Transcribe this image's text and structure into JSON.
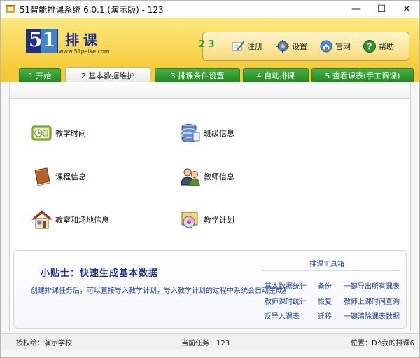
{
  "window": {
    "title": "51智能排课系统 6.0.1 (演示版) - 123",
    "controls": {
      "minimize": "—",
      "maximize": "☐",
      "close": "✕"
    }
  },
  "logo": {
    "digit_5": "5",
    "digit_1": "1",
    "name": "排课",
    "url": "www.51paike.com"
  },
  "toolbar": {
    "number": "2 3",
    "items": [
      {
        "label": "注册",
        "icon": "register-icon"
      },
      {
        "label": "设置",
        "icon": "gear-icon"
      },
      {
        "label": "官网",
        "icon": "website-icon"
      },
      {
        "label": "帮助",
        "icon": "help-icon"
      }
    ]
  },
  "tabs": [
    {
      "label": "1 开始",
      "active": false
    },
    {
      "label": "2 基本数据维护",
      "active": true
    },
    {
      "label": "3 排课条件设置",
      "active": false
    },
    {
      "label": "4 自动排课",
      "active": false
    },
    {
      "label": "5 查看课表(手工调课)",
      "active": false
    }
  ],
  "functions": [
    {
      "label": "教学时间",
      "icon": "teaching-time-icon"
    },
    {
      "label": "班级信息",
      "icon": "class-info-icon"
    },
    {
      "label": "课程信息",
      "icon": "course-book-icon"
    },
    {
      "label": "教师信息",
      "icon": "teachers-icon"
    },
    {
      "label": "教室和场地信息",
      "icon": "classroom-house-icon"
    },
    {
      "label": "教学计划",
      "icon": "teaching-plan-icon"
    }
  ],
  "tips": {
    "title": "小贴士：快速生成基本数据",
    "text": "创建排课任务后，可以直接导入教学计划，导入教学计划的过程中系统会自动生成基本数据"
  },
  "tools": {
    "title": "排课工具箱",
    "links": [
      "基本数据统计",
      "备份",
      "一键导出所有课表",
      "教师课时统计",
      "恢复",
      "教师上课时间查询",
      "反导入课表",
      "迁移",
      "一键清除课表数据"
    ]
  },
  "status": {
    "license": "授权给：演示学校",
    "task": "当前任务：123",
    "location": "位置：D:\\我的排课6"
  },
  "colors": {
    "header_yellow": "#f6ca37",
    "tab_green": "#1f8a1f",
    "logo_blue": "#1e2f86",
    "link_blue": "#1f3f9a"
  }
}
